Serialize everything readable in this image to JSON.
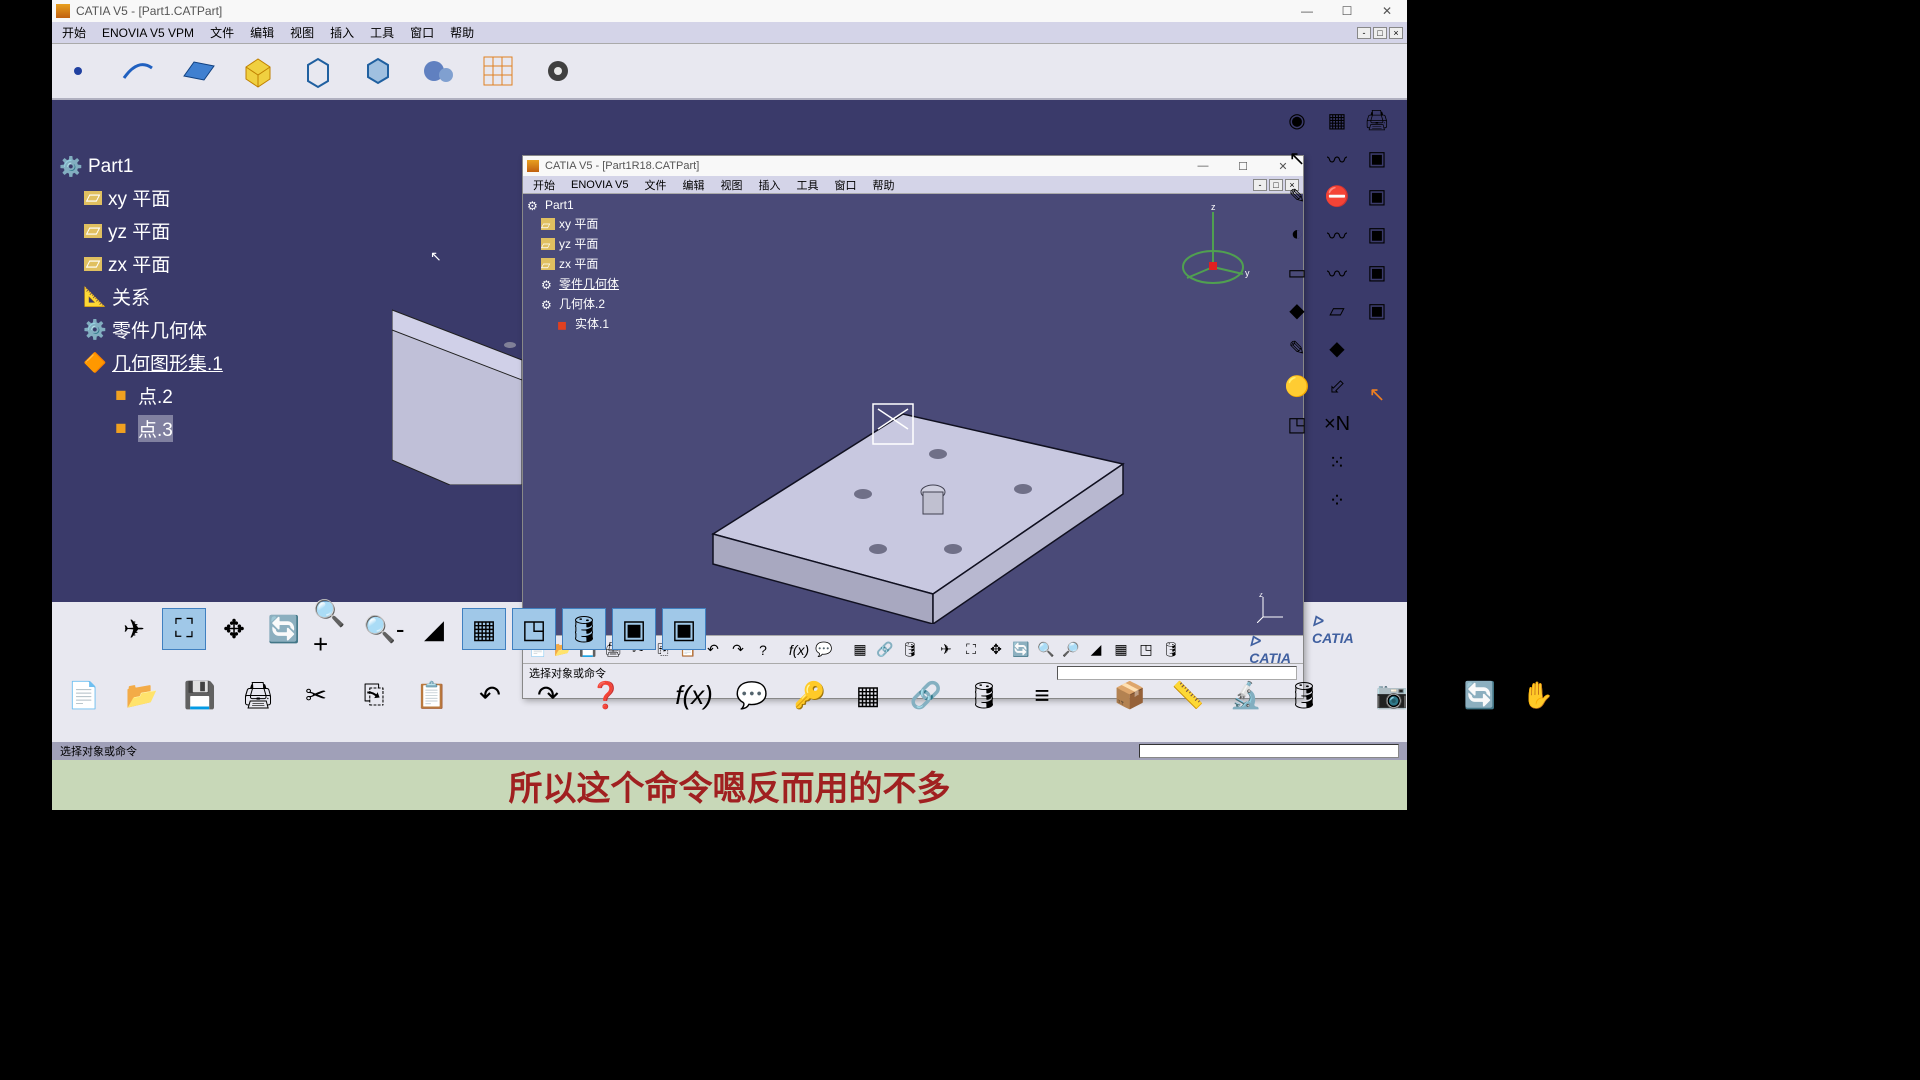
{
  "main_window": {
    "title": "CATIA V5 - [Part1.CATPart]",
    "menu": [
      "开始",
      "ENOVIA V5 VPM",
      "文件",
      "编辑",
      "视图",
      "插入",
      "工具",
      "窗口",
      "帮助"
    ],
    "status": "选择对象或命令"
  },
  "main_tree": {
    "root": "Part1",
    "items": [
      "xy 平面",
      "yz 平面",
      "zx 平面",
      "关系",
      "零件几何体",
      "几何图形集.1"
    ],
    "subitems": [
      "点.2",
      "点.3"
    ]
  },
  "inner_window": {
    "title": "CATIA V5 - [Part1R18.CATPart]",
    "menu": [
      "开始",
      "ENOVIA V5",
      "文件",
      "编辑",
      "视图",
      "插入",
      "工具",
      "窗口",
      "帮助"
    ],
    "status": "选择对象或命令"
  },
  "inner_tree": {
    "root": "Part1",
    "items": [
      "xy 平面",
      "yz 平面",
      "zx 平面",
      "零件几何体",
      "几何体.2"
    ],
    "subitems": [
      "实体.1"
    ]
  },
  "subtitle_text": "所以这个命令嗯反而用的不多",
  "catia_brand": "CATIA"
}
